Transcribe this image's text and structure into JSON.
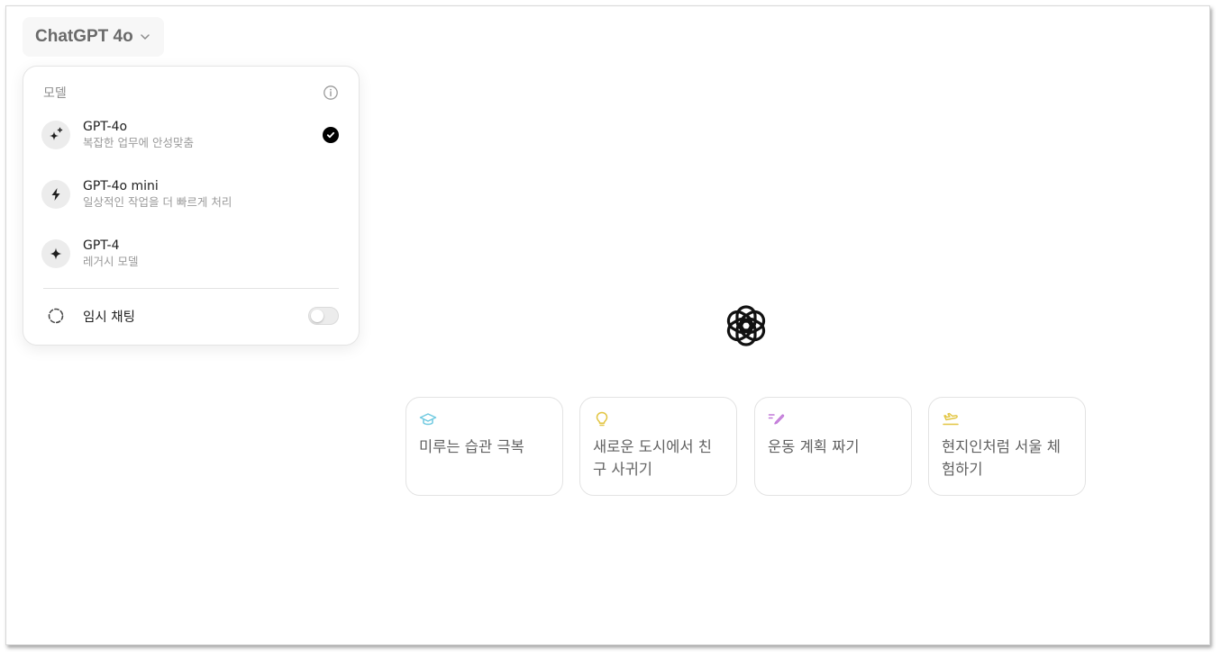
{
  "header": {
    "model_name": "ChatGPT 4o"
  },
  "dropdown": {
    "title": "모델",
    "models": [
      {
        "label": "GPT-4o",
        "desc": "복잡한 업무에 안성맞춤",
        "icon": "sparkle-plus-icon",
        "selected": true
      },
      {
        "label": "GPT-4o mini",
        "desc": "일상적인 작업을 더 빠르게 처리",
        "icon": "lightning-icon",
        "selected": false
      },
      {
        "label": "GPT-4",
        "desc": "레거시 모델",
        "icon": "sparkle-icon",
        "selected": false
      }
    ],
    "temporary_chat": {
      "label": "임시 채팅",
      "enabled": false
    }
  },
  "suggestions": [
    {
      "text": "미루는 습관 극복",
      "icon": "graduation-cap-icon",
      "color": "#6ec9e0"
    },
    {
      "text": "새로운 도시에서 친구 사귀기",
      "icon": "lightbulb-icon",
      "color": "#e2c541"
    },
    {
      "text": "운동 계획 짜기",
      "icon": "pen-icon",
      "color": "#c27ad9"
    },
    {
      "text": "현지인처럼 서울 체험하기",
      "icon": "plane-icon",
      "color": "#e2c541"
    }
  ]
}
